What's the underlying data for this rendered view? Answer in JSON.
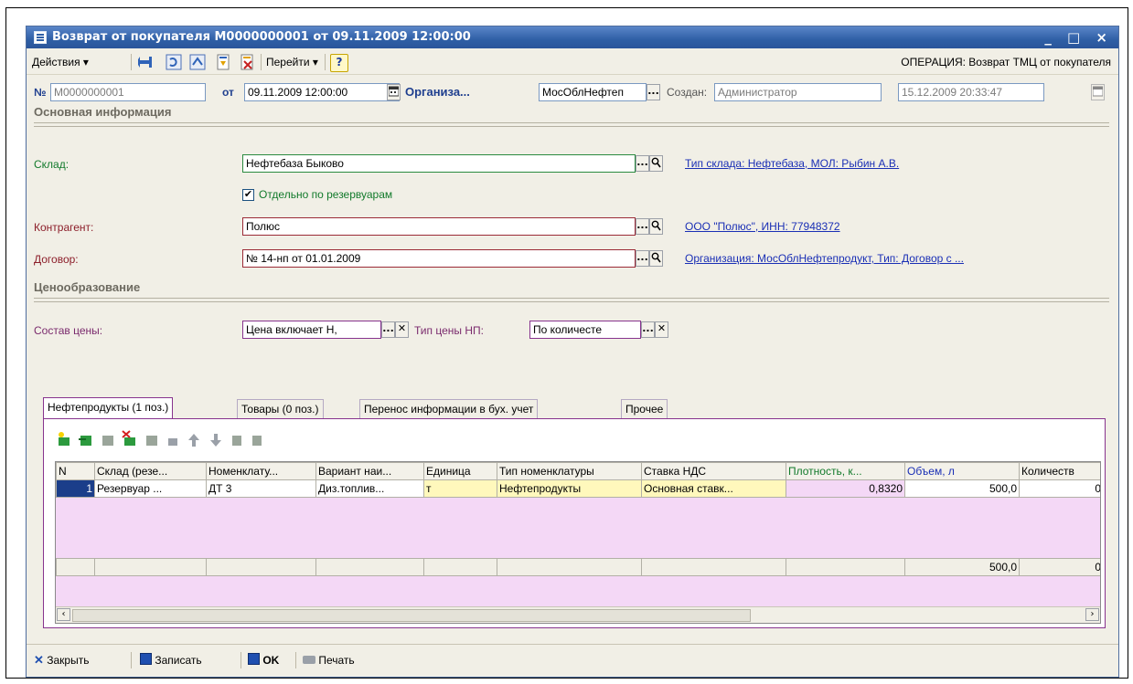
{
  "window": {
    "title": "Возврат от покупателя М0000000001 от 09.11.2009 12:00:00",
    "controls": "_ □ ×"
  },
  "toolbar": {
    "actions_label": "Действия ▾",
    "goto_label": "Перейти ▾",
    "help_label": "?",
    "operation_label": "ОПЕРАЦИЯ: Возврат ТМЦ от покупателя"
  },
  "header": {
    "number_label": "№",
    "number_value": "М0000000001",
    "date_label": "от",
    "date_value": "09.11.2009 12:00:00",
    "org_label": "Организа...",
    "org_value": "МосОблНефтеп",
    "created_label": "Создан:",
    "created_value": "Администратор",
    "created_date": "15.12.2009 20:33:47"
  },
  "sections": {
    "main_info": "Основная информация",
    "pricing": "Ценообразование"
  },
  "main": {
    "warehouse_label": "Склад:",
    "warehouse_value": "Нефтебаза Быково",
    "warehouse_link": "Тип склада: Нефтебаза, МОЛ: Рыбин А.В.",
    "reservoir_checkbox_label": "Отдельно по резервуарам",
    "reservoir_checked": true,
    "counterparty_label": "Контрагент:",
    "counterparty_value": "Полюс",
    "counterparty_link": "ООО \"Полюс\", ИНН: 77948372",
    "contract_label": "Договор:",
    "contract_value": "№ 14-нп от 01.01.2009",
    "contract_link": "Организация: МосОблНефтепродукт, Тип: Договор с ..."
  },
  "pricing": {
    "price_composition_label": "Состав цены:",
    "price_composition_value": "Цена включает Н,",
    "price_type_label": "Тип цены НП:",
    "price_type_value": "По количесте"
  },
  "tabs": [
    {
      "label": "Нефтепродукты (1 поз.)",
      "active": true
    },
    {
      "label": "Товары (0 поз.)",
      "active": false
    },
    {
      "label": "Перенос информации в бух. учет",
      "active": false
    },
    {
      "label": "Прочее",
      "active": false
    }
  ],
  "grid": {
    "columns": [
      "N",
      "Склад (резе...",
      "Номенклату...",
      "Вариант наи...",
      "Единица",
      "Тип номенклатуры",
      "Ставка НДС",
      "Плотность, к...",
      "Объем, л",
      "Количеств"
    ],
    "rows": [
      [
        "1",
        "Резервуар ...",
        "ДТ 3",
        "Диз.топлив...",
        "т",
        "Нефтепродукты",
        "Основная ставк...",
        "0,8320",
        "500,0",
        "0"
      ]
    ],
    "totals": [
      "",
      "",
      "",
      "",
      "",
      "",
      "",
      "",
      "500,0",
      "0"
    ]
  },
  "bottom": {
    "close_label": "Закрыть",
    "save_label": "Записать",
    "ok_label": "OK",
    "print_label": "Печать"
  },
  "colors": {
    "title_bar": "#2f5fa6",
    "tab_border": "#87338e",
    "grid_highlight": "#f4d8f6",
    "link": "#1a2fb5"
  }
}
